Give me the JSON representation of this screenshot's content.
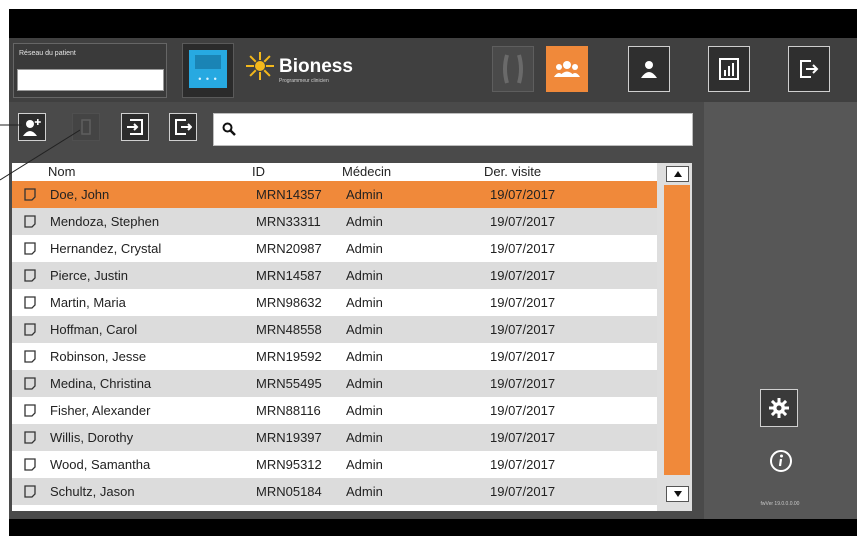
{
  "patient_network": {
    "label": "Réseau du patient",
    "value": ""
  },
  "device": {
    "dots": "• • •"
  },
  "logo": {
    "name": "Bioness",
    "tagline": "Programmeur clinicien"
  },
  "nav": [
    {
      "name": "devices-nav-button",
      "icon": "device-pair-icon",
      "state": "inactive"
    },
    {
      "name": "patients-nav-button",
      "icon": "users-icon",
      "state": "active"
    },
    {
      "name": "patient-profile-nav-button",
      "icon": "user-icon",
      "state": "normal"
    },
    {
      "name": "reports-nav-button",
      "icon": "report-icon",
      "state": "normal"
    },
    {
      "name": "logout-nav-button",
      "icon": "logout-icon",
      "state": "normal"
    }
  ],
  "toolbar": {
    "add_patient_icon": "add-user-icon",
    "delete_icon": "delete-icon",
    "import_icon": "import-icon",
    "export_icon": "export-icon",
    "search_value": ""
  },
  "table": {
    "headers": {
      "name": "Nom",
      "id": "ID",
      "doctor": "Médecin",
      "last_visit": "Der. visite"
    },
    "rows": [
      {
        "name": "Doe, John",
        "id": "MRN14357",
        "doctor": "Admin",
        "last_visit": "19/07/2017"
      },
      {
        "name": "Mendoza, Stephen",
        "id": "MRN33311",
        "doctor": "Admin",
        "last_visit": "19/07/2017"
      },
      {
        "name": "Hernandez, Crystal",
        "id": "MRN20987",
        "doctor": "Admin",
        "last_visit": "19/07/2017"
      },
      {
        "name": "Pierce, Justin",
        "id": "MRN14587",
        "doctor": "Admin",
        "last_visit": "19/07/2017"
      },
      {
        "name": "Martin, Maria",
        "id": "MRN98632",
        "doctor": "Admin",
        "last_visit": "19/07/2017"
      },
      {
        "name": "Hoffman, Carol",
        "id": "MRN48558",
        "doctor": "Admin",
        "last_visit": "19/07/2017"
      },
      {
        "name": "Robinson, Jesse",
        "id": "MRN19592",
        "doctor": "Admin",
        "last_visit": "19/07/2017"
      },
      {
        "name": "Medina, Christina",
        "id": "MRN55495",
        "doctor": "Admin",
        "last_visit": "19/07/2017"
      },
      {
        "name": "Fisher, Alexander",
        "id": "MRN88116",
        "doctor": "Admin",
        "last_visit": "19/07/2017"
      },
      {
        "name": "Willis, Dorothy",
        "id": "MRN19397",
        "doctor": "Admin",
        "last_visit": "19/07/2017"
      },
      {
        "name": "Wood, Samantha",
        "id": "MRN95312",
        "doctor": "Admin",
        "last_visit": "19/07/2017"
      },
      {
        "name": "Schultz, Jason",
        "id": "MRN05184",
        "doctor": "Admin",
        "last_visit": "19/07/2017"
      }
    ],
    "selected_index": 0
  },
  "scrollbar": {
    "up_icon": "arrow-up-icon",
    "down_icon": "arrow-down-icon"
  },
  "side": {
    "settings_icon": "gear-icon",
    "info_icon": "info-icon",
    "version": "fwVer 19.0.0.0.00"
  },
  "colors": {
    "accent": "#f0893a",
    "header": "#404040",
    "panel": "#575757",
    "row_alt": "#dcdcdc",
    "device_blue": "#27a9e1"
  }
}
